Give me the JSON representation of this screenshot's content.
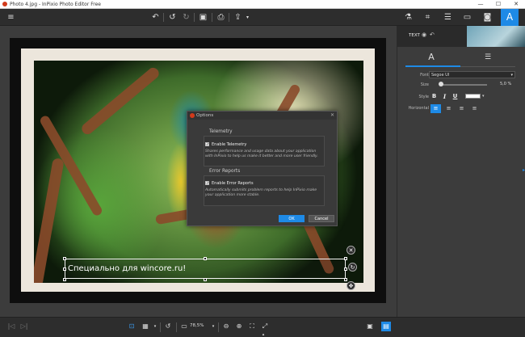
{
  "window": {
    "title": "Photo 4.jpg - InPixio Photo Editor Free",
    "minimize": "—",
    "maximize": "☐",
    "close": "✕"
  },
  "toolbar": {
    "menu_icon": "menu-icon",
    "undo_all_icon": "undo-all-icon",
    "undo_icon": "undo-icon",
    "redo_icon": "redo-icon",
    "save_icon": "save-icon",
    "print_icon": "print-icon",
    "share_icon": "share-icon",
    "right_tools": [
      "flask-icon",
      "crop-icon",
      "sliders-icon",
      "frame-icon",
      "vignette-icon",
      "text-icon"
    ],
    "active_tool": "text-icon"
  },
  "overlay_text": "Специально для wincore.ru!",
  "dialog": {
    "title": "Options",
    "close": "✕",
    "telemetry": {
      "section": "Telemetry",
      "checkbox_label": "Enable Telemetry",
      "checked": true,
      "description": "Shares performance and usage data about your application with InPixio to help us make it better and more user friendly."
    },
    "errors": {
      "section": "Error Reports",
      "checkbox_label": "Enable Error Reports",
      "checked": true,
      "description": "Automatically submits problem reports to help InPixio make your application more stable."
    },
    "ok_label": "OK",
    "cancel_label": "Cancel"
  },
  "right_panel": {
    "header_label": "TEXT",
    "tab_text_glyph": "A",
    "tab_paragraph_glyph": "☰",
    "font_label": "Font",
    "font_value": "Segoe UI",
    "size_label": "Size",
    "size_value": "5,0 %",
    "size_fraction": 0.05,
    "style_label": "Style",
    "bold": "B",
    "italic": "I",
    "underline": "U",
    "horizontal_label": "Horizontal",
    "text_color": "#ffffff"
  },
  "bottom_bar": {
    "zoom_value": "78,5%"
  },
  "colors": {
    "accent": "#1e8ae6",
    "toolbar_bg": "#2d2d2d",
    "canvas_bg": "#3c3c3c"
  }
}
